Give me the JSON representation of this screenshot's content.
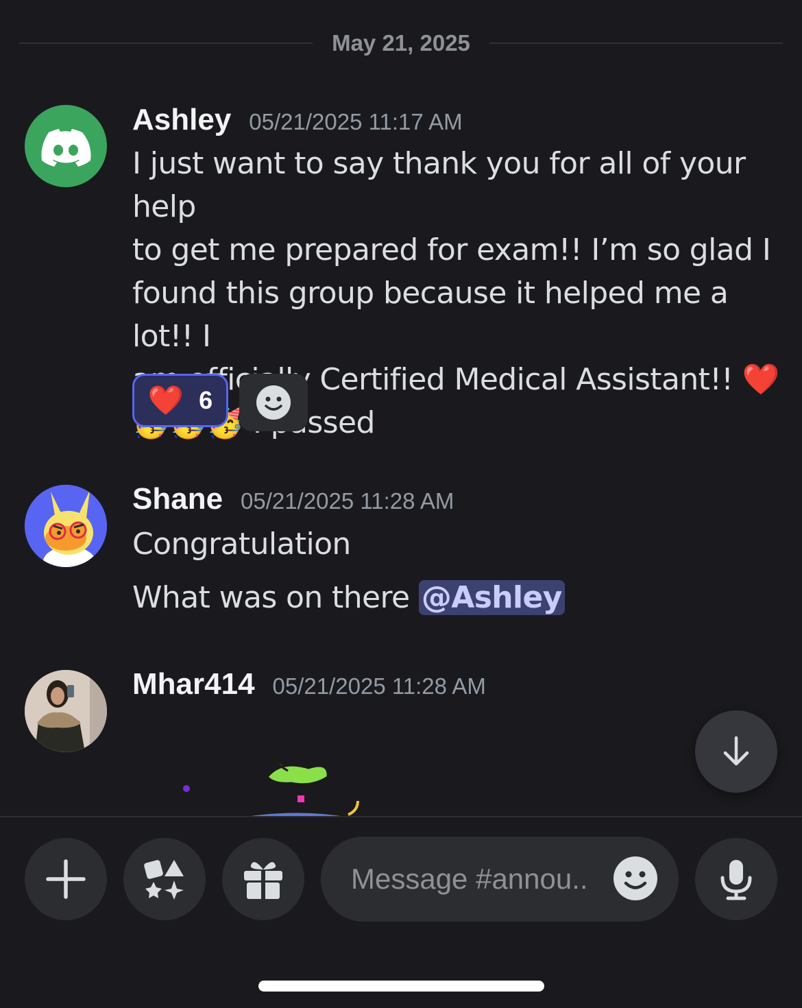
{
  "date_divider": "May 21, 2025",
  "messages": [
    {
      "username": "Ashley",
      "timestamp": "05/21/2025 11:17 AM",
      "lines": [
        "I just want to say thank you for all of your help",
        "to get me prepared for exam!! I’m so glad I",
        "found this group because it helped me a lot!! I",
        "am officially Certified Medical Assistant!! ❤️",
        "🥳🥳🥳 I passed"
      ],
      "reaction": {
        "emoji": "❤️",
        "count": "6"
      }
    },
    {
      "username": "Shane",
      "timestamp": "05/21/2025 11:28 AM",
      "line1": "Congratulation",
      "line2": "What was on there ",
      "mention": "@Ashley"
    },
    {
      "username": "Mhar414",
      "timestamp": "05/21/2025 11:28 AM"
    }
  ],
  "composer": {
    "placeholder": "Message #annou.."
  },
  "icons": {
    "add": "plus-icon",
    "apps": "apps-icon",
    "gift": "gift-icon",
    "emoji": "smiley-icon",
    "mic": "microphone-icon",
    "scroll": "arrow-down-icon"
  },
  "colors": {
    "background": "#1a1a1e",
    "accent": "#5865f2",
    "discord_green": "#3ba55d",
    "mention_bg": "#3c4270"
  }
}
